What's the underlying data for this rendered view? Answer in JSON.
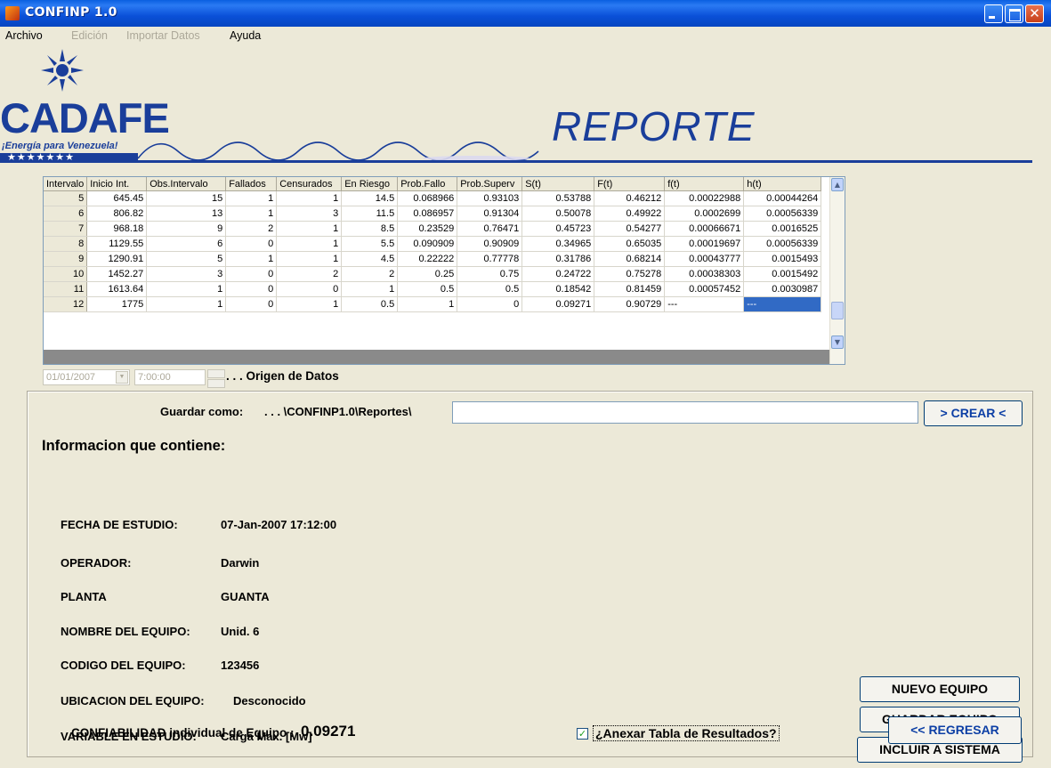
{
  "window": {
    "title": "CONFINP 1.0"
  },
  "menu": [
    {
      "label": "Archivo",
      "enabled": true
    },
    {
      "label": "Edición",
      "enabled": false
    },
    {
      "label": "Importar Datos",
      "enabled": false
    },
    {
      "label": "Ayuda",
      "enabled": true
    }
  ],
  "logo": {
    "brand": "CADAFE",
    "tagline": "¡Energía para Venezuela!",
    "stars": "★★★★★★★"
  },
  "report_title": "REPORTE",
  "table": {
    "columns": [
      "Intervalo",
      "Inicio Int.",
      "Obs.Intervalo",
      "Fallados",
      "Censurados",
      "En Riesgo",
      "Prob.Fallo",
      "Prob.Superv",
      "S(t)",
      "F(t)",
      "f(t)",
      "h(t)"
    ],
    "rows": [
      [
        "5",
        "645.45",
        "15",
        "1",
        "1",
        "14.5",
        "0.068966",
        "0.93103",
        "0.53788",
        "0.46212",
        "0.00022988",
        "0.00044264"
      ],
      [
        "6",
        "806.82",
        "13",
        "1",
        "3",
        "11.5",
        "0.086957",
        "0.91304",
        "0.50078",
        "0.49922",
        "0.0002699",
        "0.00056339"
      ],
      [
        "7",
        "968.18",
        "9",
        "2",
        "1",
        "8.5",
        "0.23529",
        "0.76471",
        "0.45723",
        "0.54277",
        "0.00066671",
        "0.0016525"
      ],
      [
        "8",
        "1129.55",
        "6",
        "0",
        "1",
        "5.5",
        "0.090909",
        "0.90909",
        "0.34965",
        "0.65035",
        "0.00019697",
        "0.00056339"
      ],
      [
        "9",
        "1290.91",
        "5",
        "1",
        "1",
        "4.5",
        "0.22222",
        "0.77778",
        "0.31786",
        "0.68214",
        "0.00043777",
        "0.0015493"
      ],
      [
        "10",
        "1452.27",
        "3",
        "0",
        "2",
        "2",
        "0.25",
        "0.75",
        "0.24722",
        "0.75278",
        "0.00038303",
        "0.0015492"
      ],
      [
        "11",
        "1613.64",
        "1",
        "0",
        "0",
        "1",
        "0.5",
        "0.5",
        "0.18542",
        "0.81459",
        "0.00057452",
        "0.0030987"
      ],
      [
        "12",
        "1775",
        "1",
        "0",
        "1",
        "0.5",
        "1",
        "0",
        "0.09271",
        "0.90729",
        "---",
        "---"
      ]
    ]
  },
  "date_controls": {
    "date": "01/01/2007",
    "time": "7:00:00",
    "origen_label": ". . . Origen de Datos"
  },
  "save": {
    "label": "Guardar como:",
    "path": ". . . \\CONFINP1.0\\Reportes\\",
    "value": "",
    "crear_button": "> CREAR <"
  },
  "info": {
    "heading": "Informacion que contiene:",
    "fecha_label": "FECHA DE ESTUDIO:",
    "fecha_value": "07-Jan-2007 17:12:00",
    "operador_label": "OPERADOR:",
    "operador_value": "Darwin",
    "planta_label": "PLANTA",
    "planta_value": "GUANTA",
    "nombre_label": "NOMBRE DEL EQUIPO:",
    "nombre_value": "Unid. 6",
    "codigo_label": "CODIGO DEL EQUIPO:",
    "codigo_value": "123456",
    "ubicacion_label": "UBICACION DEL EQUIPO:",
    "ubicacion_value": "Desconocido",
    "variable_label": "VARIABLE EN ESTUDIO:",
    "variable_value": "Carga Max. [Mw]",
    "confiabilidad_label": "CONFIABILIDAD individual de Equipo :",
    "confiabilidad_value": "0.09271"
  },
  "checkbox": {
    "label": "¿Anexar Tabla de Resultados?",
    "checked": true
  },
  "buttons": {
    "nuevo": "NUEVO EQUIPO",
    "guardar": "GUARDAR EQUIPO",
    "incluir": "INCLUIR A SISTEMA",
    "regresar": "<< REGRESAR"
  },
  "colors": {
    "brand_blue": "#1a3e9a",
    "selection": "#316ac5"
  }
}
